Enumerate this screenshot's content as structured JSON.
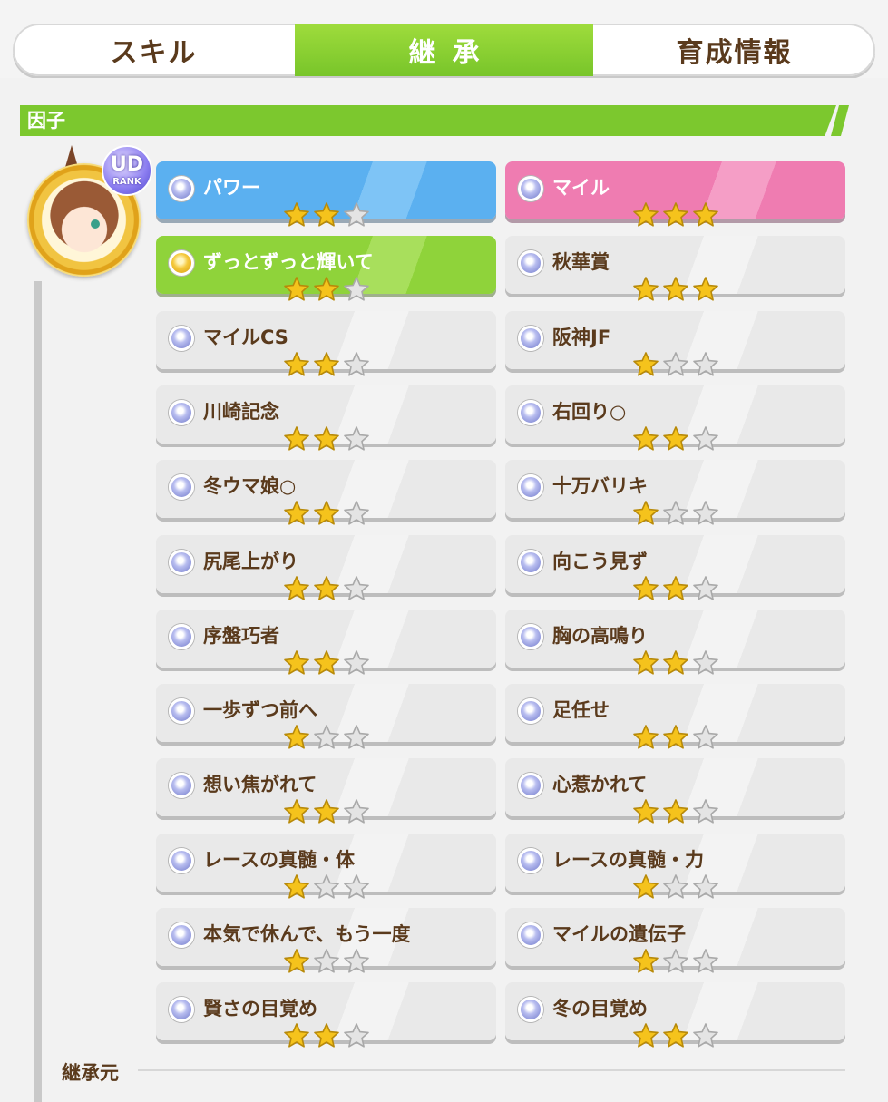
{
  "tabs": [
    {
      "label": "スキル",
      "active": false
    },
    {
      "label": "継承",
      "active": true
    },
    {
      "label": "育成情報",
      "active": false
    }
  ],
  "section": {
    "title": "因子"
  },
  "avatar": {
    "badge_top": "UD",
    "badge_bottom": "RANK"
  },
  "colors": {
    "accent_green": "#7cc82e",
    "text_brown": "#5a3a1c",
    "star_gold": "#f5c31c",
    "star_empty": "#e4e4e4"
  },
  "factors": [
    {
      "name": "パワー",
      "stars": 2,
      "style": "blue",
      "gem": "silver"
    },
    {
      "name": "マイル",
      "stars": 3,
      "style": "pink",
      "gem": "silver"
    },
    {
      "name": "ずっとずっと輝いて",
      "stars": 2,
      "style": "green",
      "gem": "gold"
    },
    {
      "name": "秋華賞",
      "stars": 3,
      "style": "white",
      "gem": "silver"
    },
    {
      "name": "マイルCS",
      "stars": 2,
      "style": "white",
      "gem": "silver"
    },
    {
      "name": "阪神JF",
      "stars": 1,
      "style": "white",
      "gem": "silver"
    },
    {
      "name": "川崎記念",
      "stars": 2,
      "style": "white",
      "gem": "silver"
    },
    {
      "name": "右回り○",
      "stars": 2,
      "style": "white",
      "gem": "silver"
    },
    {
      "name": "冬ウマ娘○",
      "stars": 2,
      "style": "white",
      "gem": "silver"
    },
    {
      "name": "十万バリキ",
      "stars": 1,
      "style": "white",
      "gem": "silver"
    },
    {
      "name": "尻尾上がり",
      "stars": 2,
      "style": "white",
      "gem": "silver"
    },
    {
      "name": "向こう見ず",
      "stars": 2,
      "style": "white",
      "gem": "silver"
    },
    {
      "name": "序盤巧者",
      "stars": 2,
      "style": "white",
      "gem": "silver"
    },
    {
      "name": "胸の高鳴り",
      "stars": 2,
      "style": "white",
      "gem": "silver"
    },
    {
      "name": "一歩ずつ前へ",
      "stars": 1,
      "style": "white",
      "gem": "silver"
    },
    {
      "name": "足任せ",
      "stars": 2,
      "style": "white",
      "gem": "silver"
    },
    {
      "name": "想い焦がれて",
      "stars": 2,
      "style": "white",
      "gem": "silver"
    },
    {
      "name": "心惹かれて",
      "stars": 2,
      "style": "white",
      "gem": "silver"
    },
    {
      "name": "レースの真髄・体",
      "stars": 1,
      "style": "white",
      "gem": "silver"
    },
    {
      "name": "レースの真髄・力",
      "stars": 1,
      "style": "white",
      "gem": "silver"
    },
    {
      "name": "本気で休んで、もう一度",
      "stars": 1,
      "style": "white",
      "gem": "silver"
    },
    {
      "name": "マイルの遺伝子",
      "stars": 1,
      "style": "white",
      "gem": "silver"
    },
    {
      "name": "賢さの目覚め",
      "stars": 2,
      "style": "white",
      "gem": "silver"
    },
    {
      "name": "冬の目覚め",
      "stars": 2,
      "style": "white",
      "gem": "silver"
    }
  ],
  "footer": {
    "label": "継承元"
  }
}
